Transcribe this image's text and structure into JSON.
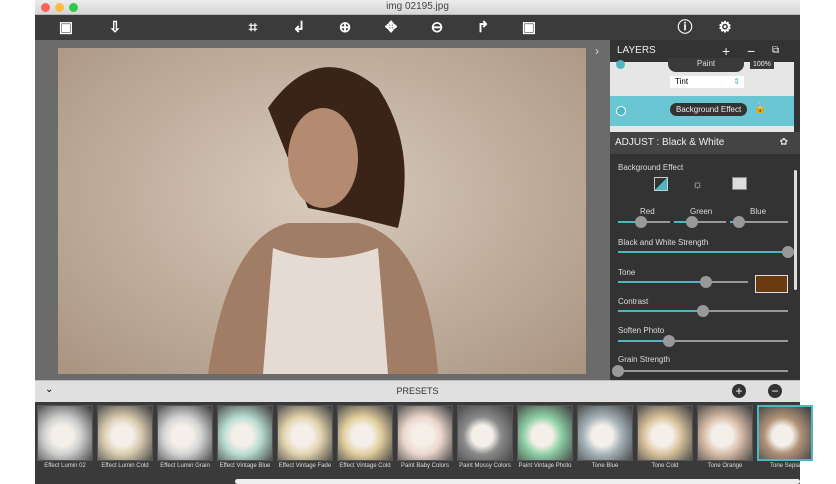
{
  "window": {
    "title": "img 02195.jpg"
  },
  "toolbar": {
    "icons": [
      "frame-icon",
      "export-icon",
      "crop-icon",
      "rotate-left-icon",
      "zoom-in-icon",
      "move-icon",
      "zoom-out-icon",
      "rotate-right-icon",
      "fit-icon",
      "info-icon",
      "settings-icon"
    ]
  },
  "layers": {
    "title": "LAYERS",
    "add": "+",
    "remove": "−",
    "paint_label": "Paint",
    "opacity": "100%",
    "blend_mode": "Tint",
    "bg_layer": "Background Effect"
  },
  "adjust": {
    "title": "ADJUST : Black & White",
    "section": "Background Effect",
    "sliders": [
      {
        "label": "Red",
        "value": 0.45
      },
      {
        "label": "Green",
        "value": 0.35
      },
      {
        "label": "Blue",
        "value": 0.15
      },
      {
        "label": "Black and White Strength",
        "value": 1.0
      },
      {
        "label": "Tone",
        "value": 0.68
      },
      {
        "label": "Contrast",
        "value": 0.5
      },
      {
        "label": "Soften Photo",
        "value": 0.3
      },
      {
        "label": "Grain Strength",
        "value": 0.0
      }
    ],
    "tone_color": "#6b3a10"
  },
  "presets": {
    "title": "PRESETS",
    "items": [
      {
        "label": "Effect Lumin 02",
        "tint": "#cfcfcf"
      },
      {
        "label": "Effect Lumin Cold",
        "tint": "#d9ccb0"
      },
      {
        "label": "Effect Lumin Grain",
        "tint": "#d4d4d4"
      },
      {
        "label": "Effect Vintage Blue",
        "tint": "#b9ddd2"
      },
      {
        "label": "Effect Vintage Fade",
        "tint": "#e3d3ad"
      },
      {
        "label": "Effect Vintage Cold",
        "tint": "#e3cf9f"
      },
      {
        "label": "Paint Baby Colors",
        "tint": "#ecd6cc"
      },
      {
        "label": "Paint Mossy Colors",
        "tint": "#8a8a8a"
      },
      {
        "label": "Paint Vintage Photo",
        "tint": "#8fd1a6"
      },
      {
        "label": "Tone Blue",
        "tint": "#a7b5bb"
      },
      {
        "label": "Tone Cold",
        "tint": "#d9c29c"
      },
      {
        "label": "Tone Orange",
        "tint": "#d8bca8"
      },
      {
        "label": "Tone Sepia",
        "tint": "#b09378"
      }
    ]
  },
  "accent": "#4fb6c4"
}
